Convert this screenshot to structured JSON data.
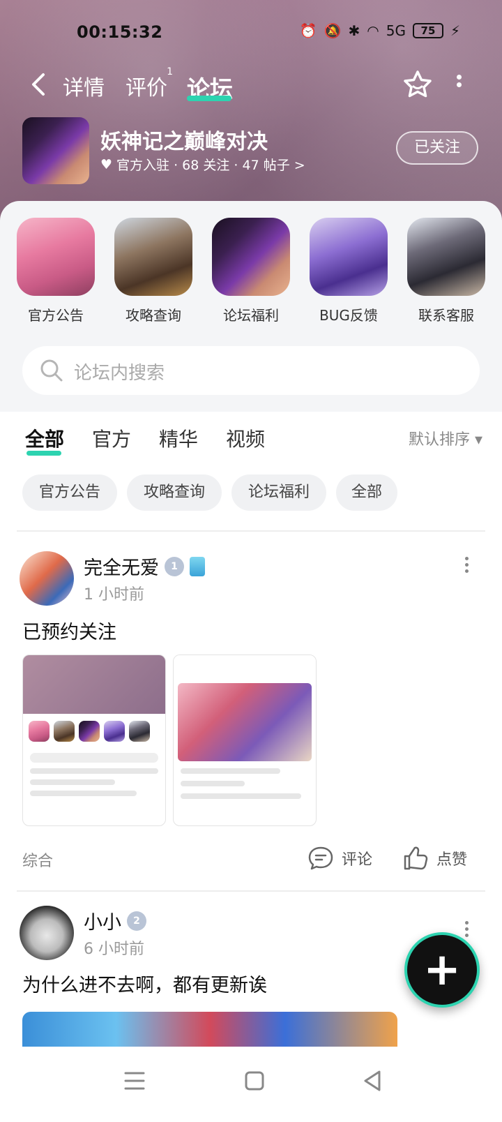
{
  "status_bar": {
    "time": "00:15:32",
    "battery": "75",
    "signal": "5G"
  },
  "top_nav": {
    "tabs": [
      {
        "label": "详情"
      },
      {
        "label": "评价",
        "badge": "1"
      },
      {
        "label": "论坛"
      }
    ]
  },
  "forum": {
    "title": "妖神记之巅峰对决",
    "meta": "官方入驻 · 68 关注 · 47 帖子 >",
    "follow_label": "已关注"
  },
  "quick_links": [
    {
      "label": "官方公告"
    },
    {
      "label": "攻略查询"
    },
    {
      "label": "论坛福利"
    },
    {
      "label": "BUG反馈"
    },
    {
      "label": "联系客服"
    }
  ],
  "search": {
    "placeholder": "论坛内搜索"
  },
  "feed_tabs": [
    {
      "label": "全部"
    },
    {
      "label": "官方"
    },
    {
      "label": "精华"
    },
    {
      "label": "视频"
    }
  ],
  "sort_label": "默认排序 ▾",
  "chips": [
    {
      "label": "官方公告"
    },
    {
      "label": "攻略查询"
    },
    {
      "label": "论坛福利"
    },
    {
      "label": "全部"
    }
  ],
  "posts": [
    {
      "user": "完全无爱",
      "level": "1",
      "time": "1 小时前",
      "text": "已预约关注",
      "tag": "综合",
      "comment_label": "评论",
      "like_label": "点赞"
    },
    {
      "user": "小小",
      "level": "2",
      "time": "6 小时前",
      "text": "为什么进不去啊，都有更新诶"
    }
  ]
}
